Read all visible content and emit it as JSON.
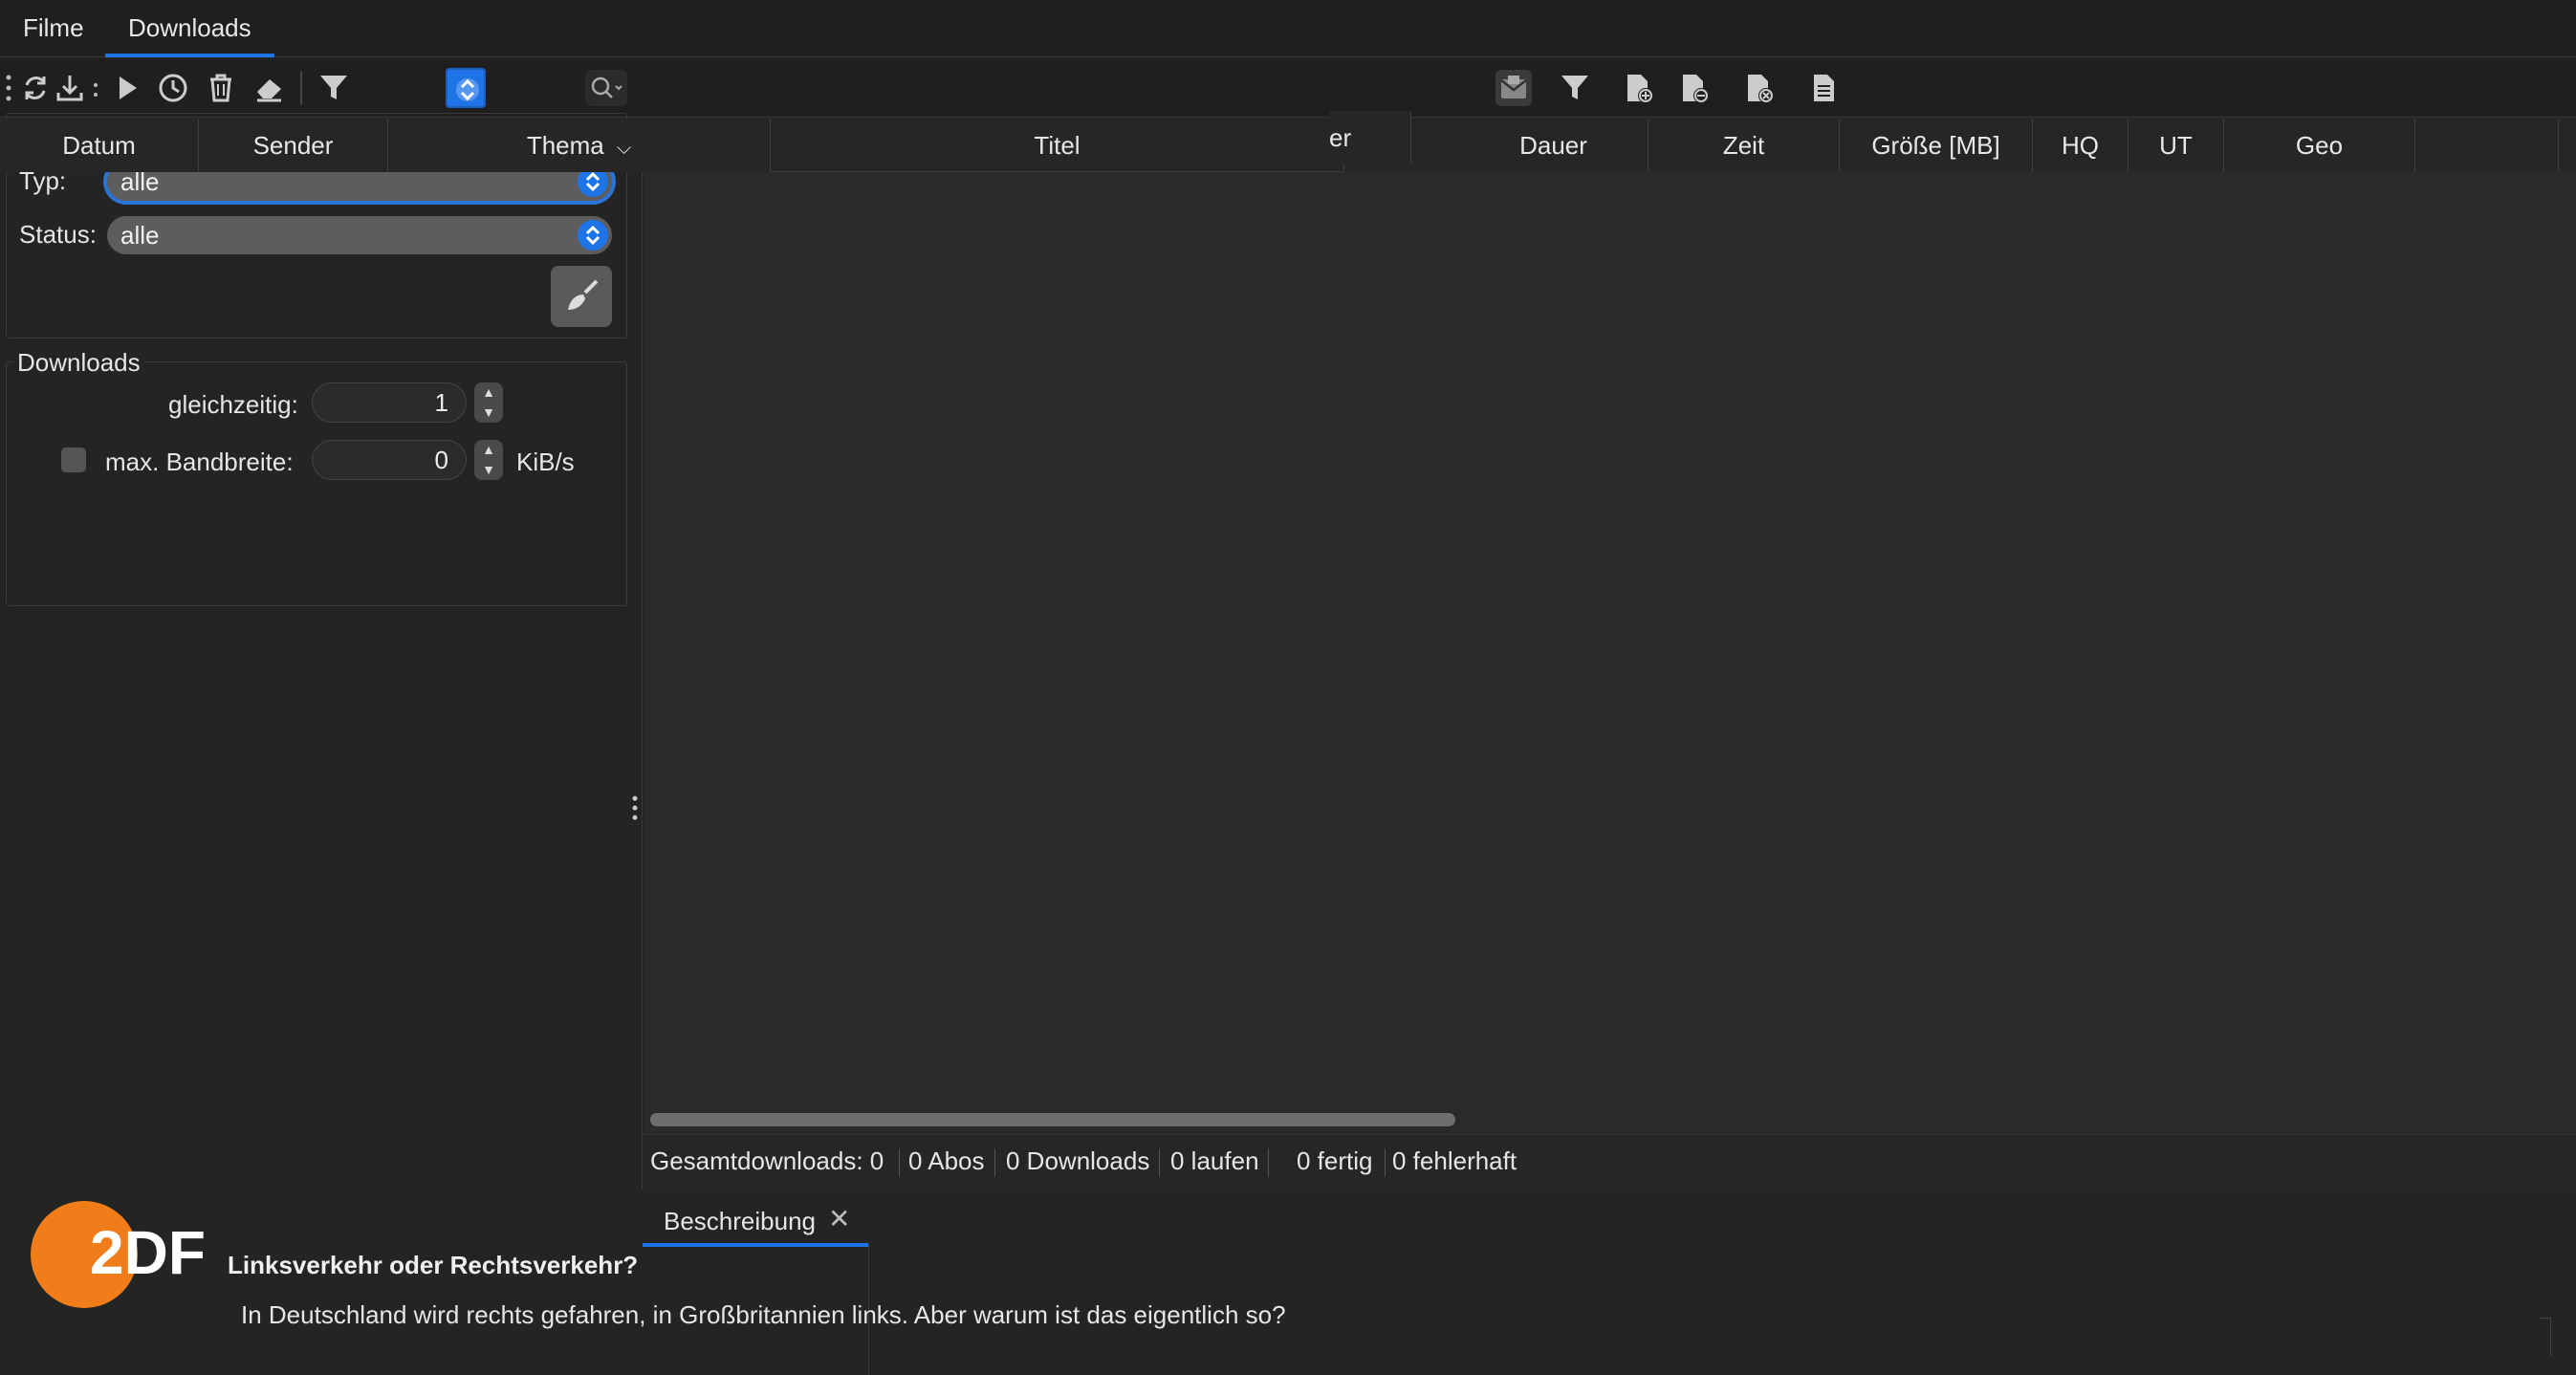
{
  "tabs": [
    {
      "label": "Filme"
    },
    {
      "label": "Downloads",
      "active": true
    }
  ],
  "filters": {
    "typ_label": "Typ:",
    "typ_value": "alle",
    "status_label": "Status:",
    "status_value": "alle"
  },
  "downloads_group": {
    "title": "Downloads",
    "gleichzeitig_label": "gleichzeitig:",
    "gleichzeitig_value": "1",
    "bandbreite_label": "max. Bandbreite:",
    "bandbreite_value": "0",
    "bandbreite_unit": "KiB/s",
    "bandbreite_checked": false
  },
  "columns": {
    "datum": "Datum",
    "sender": "Sender",
    "thema": "Thema",
    "titel": "Titel",
    "hidden_partial": "er",
    "dauer": "Dauer",
    "zeit": "Zeit",
    "groesse": "Größe [MB]",
    "hq": "HQ",
    "ut": "UT",
    "geo": "Geo"
  },
  "status": {
    "gesamt": "Gesamtdownloads: 0",
    "abos": "0 Abos",
    "downloads": "0 Downloads",
    "laufen": "0 laufen",
    "fertig": "0 fertig",
    "fehlerhaft": "0 fehlerhaft"
  },
  "description": {
    "tab_label": "Beschreibung",
    "logo_text": "2DF",
    "title": "Linksverkehr oder Rechtsverkehr?",
    "text": "In Deutschland wird rechts gefahren, in Großbritannien links. Aber warum ist das eigentlich so?"
  },
  "colors": {
    "accent": "#1e73e6",
    "zdf_orange": "#f07d1a",
    "background": "#262626"
  }
}
